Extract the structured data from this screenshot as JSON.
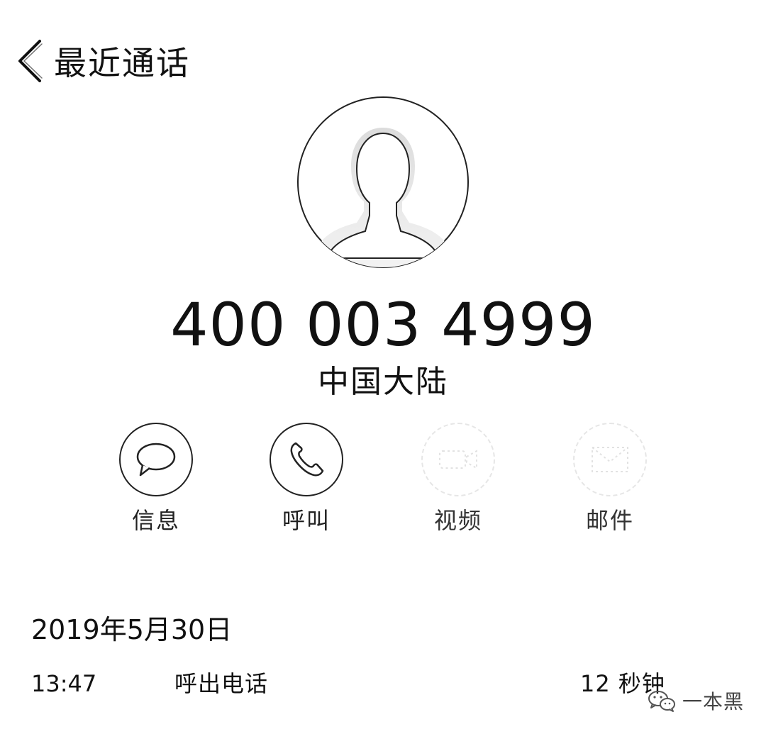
{
  "nav": {
    "back_label": "最近通话"
  },
  "contact": {
    "phone_number": "400 003 4999",
    "region": "中国大陆"
  },
  "actions": [
    {
      "label": "信息",
      "icon": "message-bubble-icon",
      "enabled": true
    },
    {
      "label": "呼叫",
      "icon": "phone-handset-icon",
      "enabled": true
    },
    {
      "label": "视频",
      "icon": "video-camera-icon",
      "enabled": false
    },
    {
      "label": "邮件",
      "icon": "mail-envelope-icon",
      "enabled": false
    }
  ],
  "call_history": {
    "date": "2019年5月30日",
    "entries": [
      {
        "time": "13:47",
        "type": "呼出电话",
        "duration": "12 秒钟"
      }
    ]
  },
  "watermark": {
    "text": "一本黑",
    "icon": "wechat-icon"
  },
  "colors": {
    "background": "#ffffff",
    "text": "#111111",
    "disabled_outline": "#e6e6e6"
  }
}
